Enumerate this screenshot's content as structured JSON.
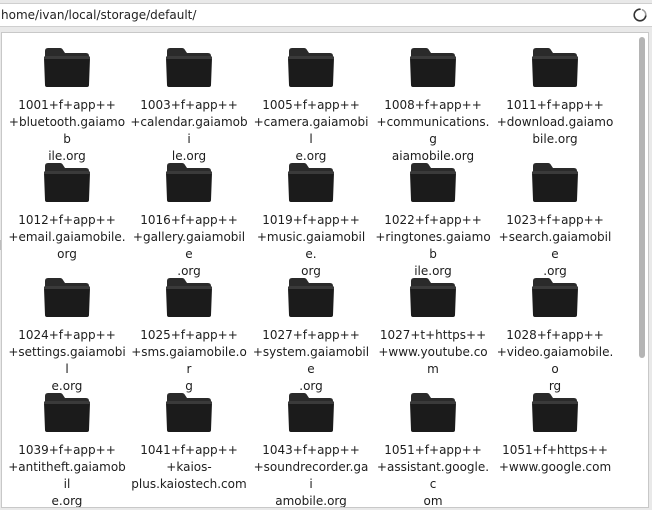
{
  "location": {
    "path": "home/ivan/local/storage/default/",
    "reload_icon": "reload-icon"
  },
  "folders": [
    {
      "label": "1001+f+app++\n+bluetooth.gaiamob\nile.org"
    },
    {
      "label": "1003+f+app++\n+calendar.gaiamobi\nle.org"
    },
    {
      "label": "1005+f+app++\n+camera.gaiamobil\ne.org"
    },
    {
      "label": "1008+f+app++\n+communications.g\naiamobile.org"
    },
    {
      "label": "1011+f+app++\n+download.gaiamo\nbile.org"
    },
    {
      "label": "1012+f+app++\n+email.gaiamobile.\norg"
    },
    {
      "label": "1016+f+app++\n+gallery.gaiamobile\n.org"
    },
    {
      "label": "1019+f+app++\n+music.gaiamobile.\norg"
    },
    {
      "label": "1022+f+app++\n+ringtones.gaiamob\nile.org"
    },
    {
      "label": "1023+f+app++\n+search.gaiamobile\n.org"
    },
    {
      "label": "1024+f+app++\n+settings.gaiamobil\ne.org"
    },
    {
      "label": "1025+f+app++\n+sms.gaiamobile.or\ng"
    },
    {
      "label": "1027+f+app++\n+system.gaiamobile\n.org"
    },
    {
      "label": "1027+t+https++\n+www.youtube.com"
    },
    {
      "label": "1028+f+app++\n+video.gaiamobile.o\nrg"
    },
    {
      "label": "1039+f+app++\n+antitheft.gaiamobil\ne.org"
    },
    {
      "label": "1041+f+app++\n+kaios-\nplus.kaiostech.com"
    },
    {
      "label": "1043+f+app++\n+soundrecorder.gai\namobile.org"
    },
    {
      "label": "1051+f+app++\n+assistant.google.c\nom"
    },
    {
      "label": "1051+f+https++\n+www.google.com"
    }
  ],
  "colors": {
    "folder": "#1b1b1b",
    "folder_tab": "#2a2a2a",
    "background": "#ffffff",
    "toolbar": "#e9e9e9"
  }
}
